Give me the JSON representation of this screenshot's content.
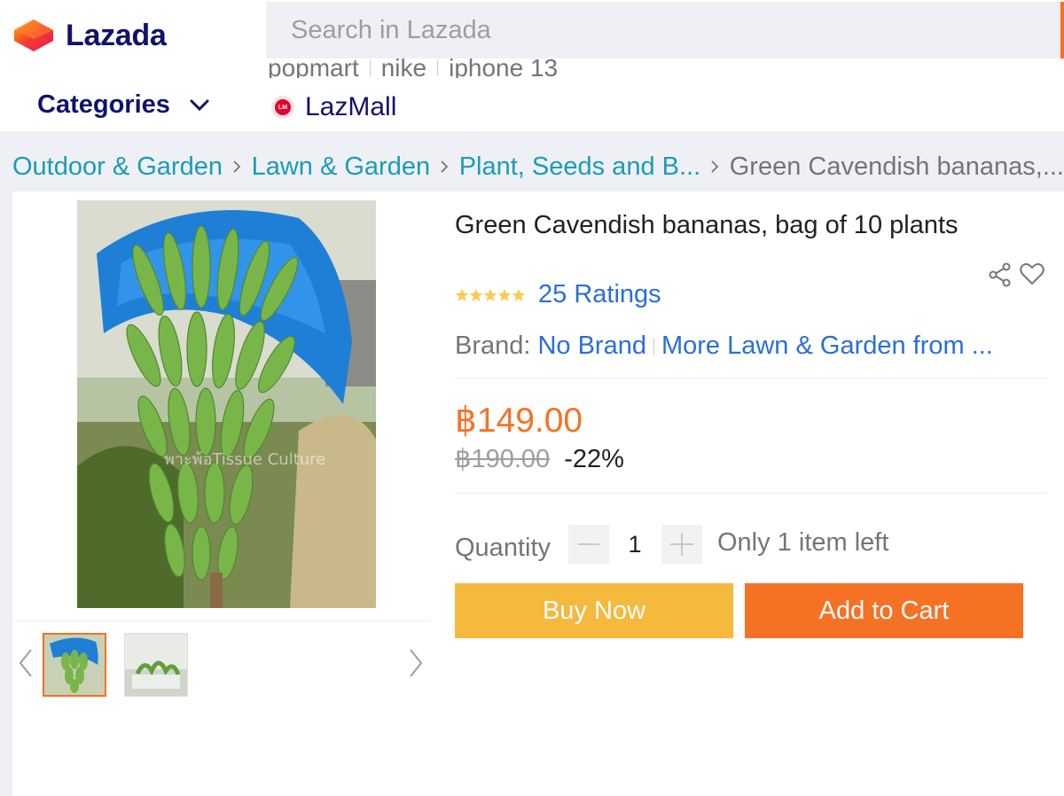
{
  "header": {
    "logo_text": "Lazada",
    "search_placeholder": "Search in Lazada",
    "suggestions": [
      "popmart",
      "nike",
      "iphone 13"
    ],
    "categories_label": "Categories",
    "lazmall_label": "LazMall",
    "lazmall_badge": "LM",
    "colors": {
      "brand_navy": "#0f136d",
      "accent_orange": "#f57224"
    }
  },
  "breadcrumb": {
    "items": [
      "Outdoor & Garden",
      "Lawn & Garden",
      "Plant, Seeds and B..."
    ],
    "current": "Green Cavendish bananas,..."
  },
  "gallery": {
    "main_image": "banana-bunch-photo",
    "watermark": "พาะพ้อTissue Culture",
    "thumbnails": [
      "banana-bunch-thumb",
      "banana-seedlings-thumb"
    ],
    "active_thumbnail": 0
  },
  "product": {
    "title": "Green Cavendish bananas, bag of 10 plants",
    "rating_stars": 5,
    "ratings_text": "25 Ratings",
    "brand_label": "Brand:",
    "brand_name": "No Brand",
    "brand_more": "More Lawn & Garden from ...",
    "price": "฿149.00",
    "original_price": "฿190.00",
    "discount": "-22%",
    "quantity_label": "Quantity",
    "quantity_value": "1",
    "stock_note": "Only 1 item left",
    "buy_now_label": "Buy Now",
    "add_to_cart_label": "Add to Cart",
    "colors": {
      "price": "#f57224",
      "buy_now": "#f5b93e",
      "add_to_cart": "#f57224",
      "link": "#2a6fd6"
    }
  }
}
